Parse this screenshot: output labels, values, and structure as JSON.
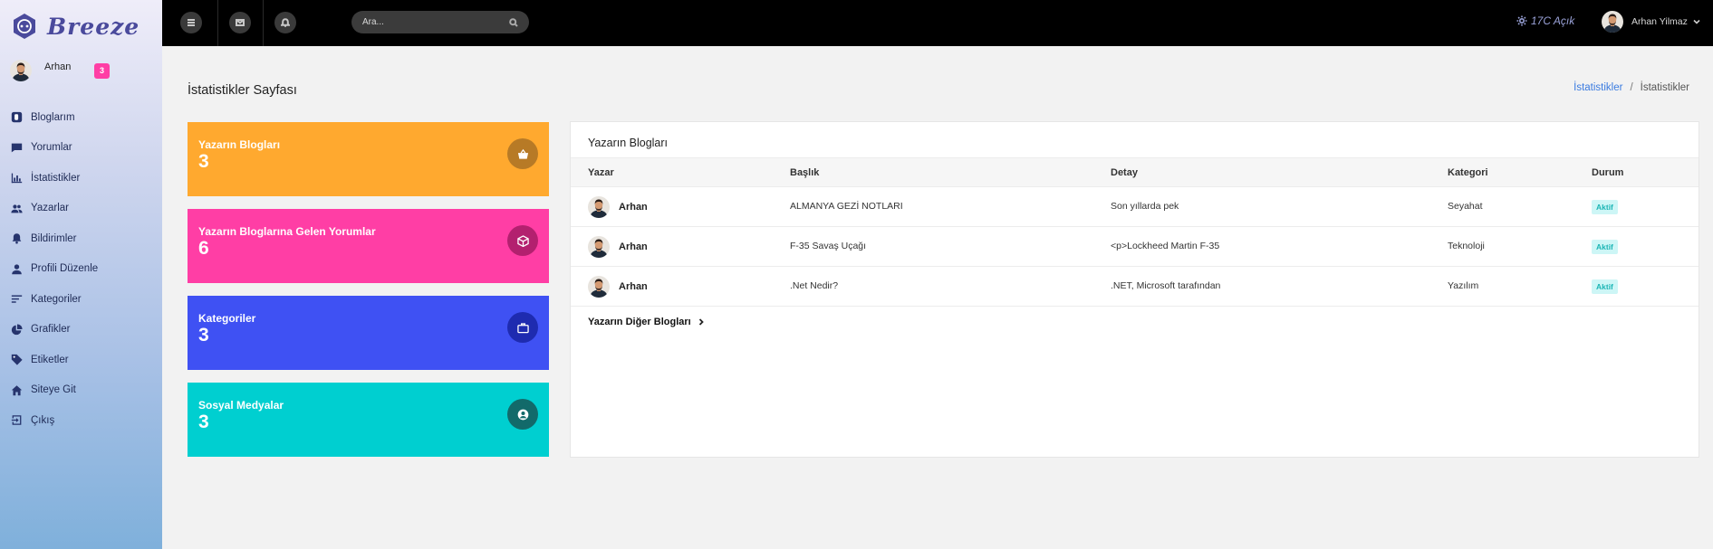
{
  "brand": {
    "name": "Breeze"
  },
  "sidebar": {
    "user_name": "Arhan",
    "notification_count": "3",
    "items": [
      {
        "label": "Bloglarım",
        "icon": "blog-icon"
      },
      {
        "label": "Yorumlar",
        "icon": "comment-icon"
      },
      {
        "label": "İstatistikler",
        "icon": "bar-chart-icon"
      },
      {
        "label": "Yazarlar",
        "icon": "users-icon"
      },
      {
        "label": "Bildirimler",
        "icon": "bell-icon"
      },
      {
        "label": "Profili Düzenle",
        "icon": "user-icon"
      },
      {
        "label": "Kategoriler",
        "icon": "sort-lines-icon"
      },
      {
        "label": "Grafikler",
        "icon": "pie-chart-icon"
      },
      {
        "label": "Etiketler",
        "icon": "tag-icon"
      },
      {
        "label": "Siteye Git",
        "icon": "home-icon"
      },
      {
        "label": "Çıkış",
        "icon": "logout-icon"
      }
    ]
  },
  "header": {
    "search_placeholder": "Ara...",
    "weather": "17C Açık",
    "user_name": "Arhan Yilmaz"
  },
  "page": {
    "title": "İstatistikler Sayfası",
    "breadcrumb": {
      "link": "İstatistikler",
      "separator": "/",
      "current": "İstatistikler"
    }
  },
  "stats": [
    {
      "label": "Yazarın Blogları",
      "value": "3",
      "color": "#ffa92f",
      "icon_bg": "#b77a26",
      "icon": "basket-icon"
    },
    {
      "label": "Yazarın Bloglarına Gelen Yorumlar",
      "value": "6",
      "color": "#ff3ea5",
      "icon_bg": "#b3206f",
      "icon": "cube-icon"
    },
    {
      "label": "Kategoriler",
      "value": "3",
      "color": "#3f51f3",
      "icon_bg": "#1e2bb0",
      "icon": "briefcase-icon"
    },
    {
      "label": "Sosyal Medyalar",
      "value": "3",
      "color": "#00cfd0",
      "icon_bg": "#126a6a",
      "icon": "user-circle-icon"
    }
  ],
  "table": {
    "title": "Yazarın Blogları",
    "columns": [
      "Yazar",
      "Başlık",
      "Detay",
      "Kategori",
      "Durum"
    ],
    "rows": [
      {
        "author": "Arhan",
        "title": "ALMANYA GEZİ NOTLARI",
        "detail": "Son yıllarda pek",
        "category": "Seyahat",
        "status": "Aktif"
      },
      {
        "author": "Arhan",
        "title": "F-35 Savaş Uçağı",
        "detail": "<p>Lockheed Martin F-35",
        "category": "Teknoloji",
        "status": "Aktif"
      },
      {
        "author": "Arhan",
        "title": ".Net Nedir?",
        "detail": ".NET, Microsoft tarafından",
        "category": "Yazılım",
        "status": "Aktif"
      }
    ],
    "more_link": "Yazarın Diğer Blogları"
  }
}
